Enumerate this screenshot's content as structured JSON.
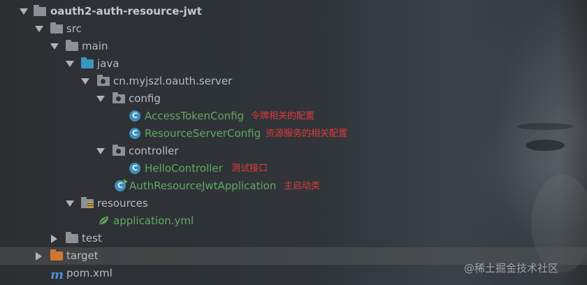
{
  "project": {
    "name": "oauth2-auth-resource-jwt",
    "src": "src",
    "main": "main",
    "java": "java",
    "package": "cn.myjszl.oauth.server",
    "config": {
      "label": "config",
      "items": [
        {
          "name": "AccessTokenConfig",
          "note": "令牌相关的配置"
        },
        {
          "name": "ResourceServerConfig",
          "note": "资源服务的相关配置"
        }
      ]
    },
    "controller": {
      "label": "controller",
      "items": [
        {
          "name": "HelloController",
          "note": "测试接口"
        }
      ]
    },
    "application_class": {
      "name": "AuthResourceJwtApplication",
      "note": "主启动类"
    },
    "resources": "resources",
    "application_yml": "application.yml",
    "test": "test",
    "target": "target",
    "pom": "pom.xml"
  },
  "icons": {
    "class_glyph": "C",
    "maven_glyph": "m"
  },
  "watermark": "@稀土掘金技术社区",
  "colors": {
    "accent_class": "#3e8fbb",
    "java_folder": "#3d95c2",
    "target_folder": "#d2762c",
    "annotation": "#e03a3a",
    "file_green": "#62a862"
  }
}
